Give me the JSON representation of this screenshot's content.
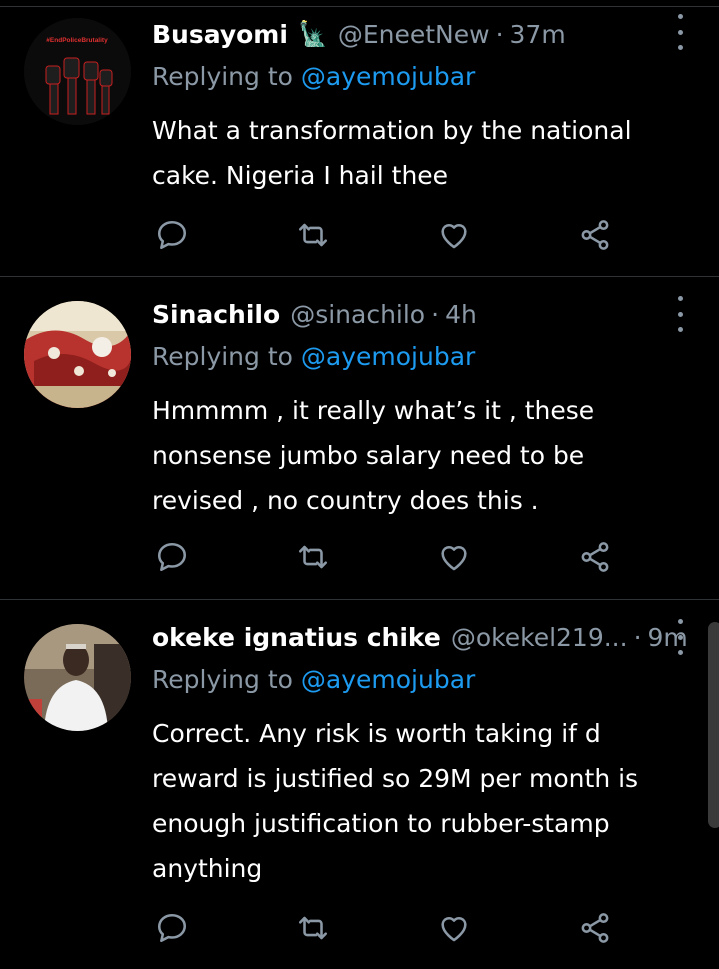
{
  "tweets": [
    {
      "name": "Busayomi",
      "name_emoji": "🗽",
      "handle": "@EneetNew",
      "separator": "·",
      "time": "37m",
      "replying_prefix": "Replying to",
      "replying_to": "@ayemojubar",
      "text": "What a transformation by the national cake. Nigeria I hail thee",
      "avatar_badge": "#EndPoliceBrutality",
      "avatar_icon": "raised-fists-icon"
    },
    {
      "name": "Sinachilo",
      "handle": "@sinachilo",
      "separator": "·",
      "time": "4h",
      "replying_prefix": "Replying to",
      "replying_to": "@ayemojubar",
      "text": "Hmmmm , it really what’s it , these nonsense  jumbo salary need to be revised , no country does this .",
      "avatar_icon": "profile-photo"
    },
    {
      "name": "okeke ignatius chike",
      "handle": "@okekel219...",
      "separator": "·",
      "time": "9m",
      "replying_prefix": "Replying to",
      "replying_to": "@ayemojubar",
      "text": "Correct. Any risk is worth taking if d reward is justified so 29M per month is enough justification to rubber-stamp anything",
      "avatar_icon": "profile-photo"
    }
  ],
  "icons": {
    "reply": "reply-icon",
    "retweet": "retweet-icon",
    "like": "like-icon",
    "share": "share-icon",
    "more": "more-options-icon"
  },
  "colors": {
    "background": "#000000",
    "text": "#ffffff",
    "secondary": "#8b98a5",
    "mention": "#1d9bf0",
    "divider": "#2f3336"
  }
}
